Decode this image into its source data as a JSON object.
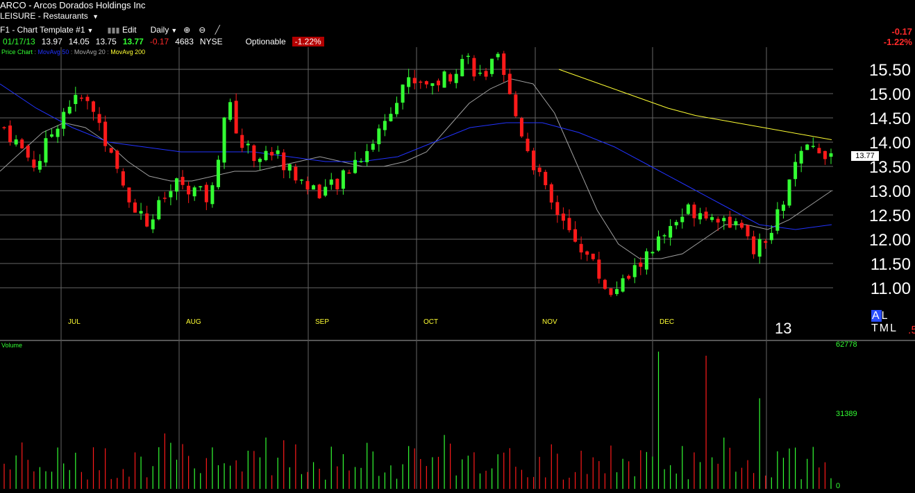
{
  "header": {
    "symbol": "ARCO",
    "company": "- Arcos Dorados Holdings Inc",
    "sector": "LEISURE",
    "industry": "- Restaurants",
    "template": "F1 - Chart Template #1",
    "edit_label": "Edit",
    "interval": "Daily",
    "quote": {
      "date": "01/17/13",
      "open": "13.97",
      "high": "14.05",
      "low": "13.75",
      "close": "13.77",
      "change": "-0.17",
      "volume": "4683",
      "exchange": "NYSE",
      "optionable": "Optionable",
      "pct_change": "-1.22%"
    },
    "right_change": "-0.17",
    "right_pct": "-1.22%"
  },
  "legend": {
    "price": "Price Chart",
    "ma50": "MovAvg 50",
    "ma20": "MovAvg 20",
    "ma200": "MovAvg 200"
  },
  "altml": {
    "a": "A",
    "rest": "L TML"
  },
  "year_label": "13",
  "edge_mark": ".5",
  "last_price_tag": "13.77",
  "volume_label": "Volume",
  "colors": {
    "up": "#33ff33",
    "down": "#ff1a1a",
    "ma20": "#a0a0a0",
    "ma50": "#2233ff",
    "ma200": "#ffff33",
    "grid": "#666666"
  },
  "chart_data": [
    {
      "type": "candlestick",
      "title": "Price Chart",
      "ylim": [
        10.5,
        16.0
      ],
      "y_ticks": [
        "15.50",
        "15.00",
        "14.50",
        "14.00",
        "13.50",
        "13.00",
        "12.50",
        "12.00",
        "11.50",
        "11.00"
      ],
      "x_month_labels": [
        "JUL",
        "AUG",
        "SEP",
        "OCT",
        "NOV",
        "DEC"
      ],
      "close_path": [
        14.3,
        13.9,
        13.5,
        14.2,
        14.8,
        14.9,
        14.4,
        13.4,
        12.8,
        12.3,
        12.8,
        13.2,
        13.0,
        12.8,
        14.9,
        13.9,
        13.7,
        13.8,
        13.4,
        13.1,
        13.0,
        13.1,
        13.6,
        13.9,
        14.5,
        15.2,
        15.3,
        15.2,
        15.4,
        15.8,
        15.3,
        15.7,
        14.7,
        13.8,
        13.0,
        12.3,
        12.0,
        11.5,
        10.9,
        11.1,
        11.5,
        11.9,
        12.3,
        12.6,
        12.6,
        12.5,
        12.3,
        11.8,
        11.9,
        12.8,
        13.7,
        13.9,
        13.77
      ],
      "close_path_note": "",
      "last": 13.77,
      "series": [
        {
          "name": "MovAvg 20",
          "values": [
            13.4,
            13.8,
            14.2,
            14.4,
            14.3,
            14.0,
            13.6,
            13.3,
            13.2,
            13.2,
            13.3,
            13.4,
            13.4,
            13.5,
            13.6,
            13.7,
            13.6,
            13.5,
            13.5,
            13.6,
            13.8,
            14.3,
            14.8,
            15.1,
            15.3,
            15.2,
            14.6,
            13.6,
            12.6,
            11.9,
            11.6,
            11.6,
            11.7,
            12.0,
            12.3,
            12.3,
            12.2,
            12.4,
            12.7,
            13.0
          ]
        },
        {
          "name": "MovAvg 50",
          "values": [
            15.2,
            14.7,
            14.3,
            14.0,
            13.9,
            13.8,
            13.8,
            13.8,
            13.7,
            13.6,
            13.6,
            13.7,
            14.0,
            14.3,
            14.4,
            14.4,
            14.2,
            13.9,
            13.5,
            13.1,
            12.7,
            12.3,
            12.2,
            12.3
          ]
        },
        {
          "name": "MovAvg 200",
          "values": [
            15.5,
            15.3,
            15.1,
            14.9,
            14.7,
            14.55,
            14.45,
            14.35,
            14.25,
            14.15,
            14.05
          ]
        }
      ]
    },
    {
      "type": "bar",
      "title": "Volume",
      "ylim": [
        0,
        62778
      ],
      "y_ticks": [
        "62778",
        "31389",
        "0"
      ]
    }
  ]
}
